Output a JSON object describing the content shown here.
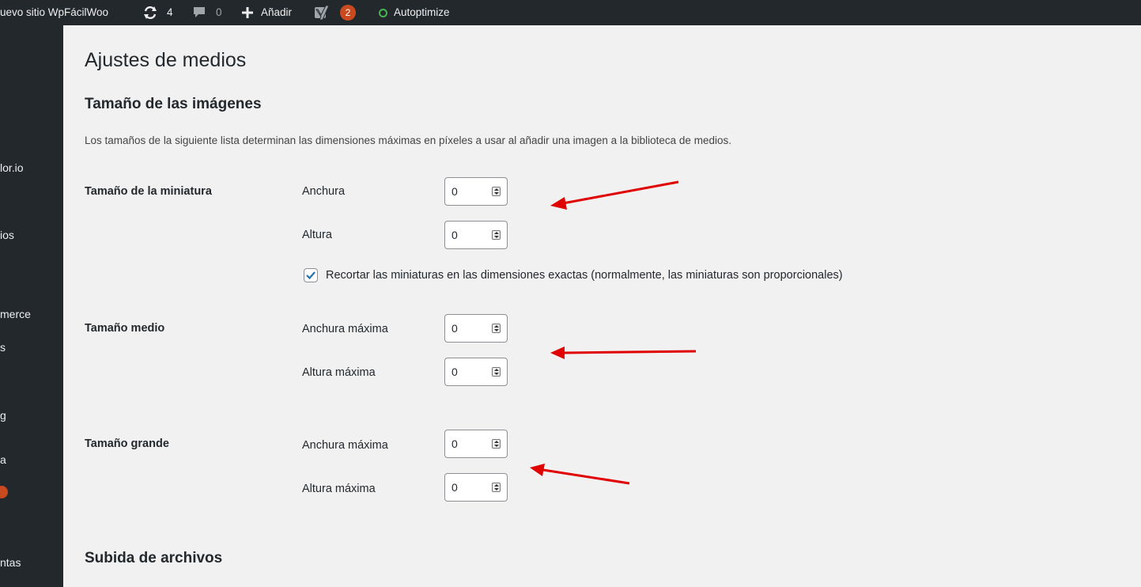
{
  "adminbar": {
    "site_name": "uevo sitio WpFácilWoo",
    "updates_count": "4",
    "comments_count": "0",
    "add_new_label": "Añadir",
    "yoast_badge": "2",
    "autoptimize_label": "Autoptimize",
    "icons": [
      "refresh-icon",
      "comment-icon",
      "plus-icon",
      "yoast-icon",
      "status-dot-icon"
    ]
  },
  "sidebar": {
    "items": [
      {
        "label": "lor.io"
      },
      {
        "label": "ios"
      },
      {
        "label": "merce"
      },
      {
        "label": "s"
      },
      {
        "label": "g"
      },
      {
        "label": "a"
      },
      {
        "label": "ntas"
      }
    ]
  },
  "page": {
    "title": "Ajustes de medios",
    "section_image_sizes": "Tamaño de las imágenes",
    "description": "Los tamaños de la siguiente lista determinan las dimensiones máximas en píxeles a usar al añadir una imagen a la biblioteca de medios.",
    "thumbnail": {
      "label": "Tamaño de la miniatura",
      "width_label": "Anchura",
      "width_value": "0",
      "height_label": "Altura",
      "height_value": "0",
      "crop_label": "Recortar las miniaturas en las dimensiones exactas (normalmente, las miniaturas son proporcionales)",
      "crop_checked": true
    },
    "medium": {
      "label": "Tamaño medio",
      "width_label": "Anchura máxima",
      "width_value": "0",
      "height_label": "Altura máxima",
      "height_value": "0"
    },
    "large": {
      "label": "Tamaño grande",
      "width_label": "Anchura máxima",
      "width_value": "0",
      "height_label": "Altura máxima",
      "height_value": "0"
    },
    "section_uploads": "Subida de archivos"
  },
  "colors": {
    "adminbar_bg": "#23282d",
    "badge": "#ca4a1f",
    "checkbox_accent": "#2271b1",
    "annotation_arrow": "#e00000",
    "autoptimize_dot": "#46b450"
  }
}
